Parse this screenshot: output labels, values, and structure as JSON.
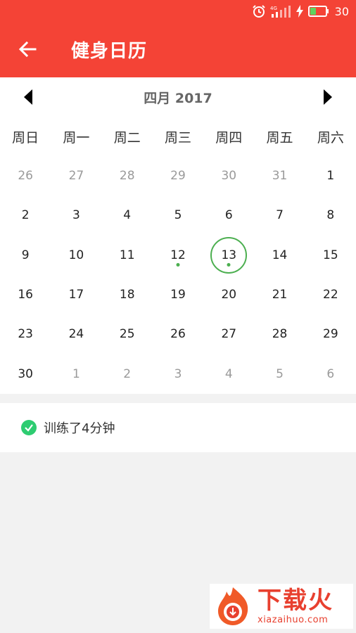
{
  "status": {
    "network": "4G",
    "battery": "30"
  },
  "toolbar": {
    "title": "健身日历"
  },
  "calendar": {
    "month_label": "四月 2017",
    "weekdays": [
      "周日",
      "周一",
      "周二",
      "周三",
      "周四",
      "周五",
      "周六"
    ],
    "days": [
      {
        "label": "26",
        "muted": true
      },
      {
        "label": "27",
        "muted": true
      },
      {
        "label": "28",
        "muted": true
      },
      {
        "label": "29",
        "muted": true
      },
      {
        "label": "30",
        "muted": true
      },
      {
        "label": "31",
        "muted": true
      },
      {
        "label": "1"
      },
      {
        "label": "2"
      },
      {
        "label": "3"
      },
      {
        "label": "4"
      },
      {
        "label": "5"
      },
      {
        "label": "6"
      },
      {
        "label": "7"
      },
      {
        "label": "8"
      },
      {
        "label": "9"
      },
      {
        "label": "10"
      },
      {
        "label": "11"
      },
      {
        "label": "12",
        "dot": true
      },
      {
        "label": "13",
        "selected": true,
        "dot": true
      },
      {
        "label": "14"
      },
      {
        "label": "15"
      },
      {
        "label": "16"
      },
      {
        "label": "17"
      },
      {
        "label": "18"
      },
      {
        "label": "19"
      },
      {
        "label": "20"
      },
      {
        "label": "21"
      },
      {
        "label": "22"
      },
      {
        "label": "23"
      },
      {
        "label": "24"
      },
      {
        "label": "25"
      },
      {
        "label": "26"
      },
      {
        "label": "27"
      },
      {
        "label": "28"
      },
      {
        "label": "29"
      },
      {
        "label": "30"
      },
      {
        "label": "1",
        "muted": true
      },
      {
        "label": "2",
        "muted": true
      },
      {
        "label": "3",
        "muted": true
      },
      {
        "label": "4",
        "muted": true
      },
      {
        "label": "5",
        "muted": true
      },
      {
        "label": "6",
        "muted": true
      }
    ]
  },
  "record": {
    "text": "训练了4分钟"
  },
  "watermark": {
    "title": "下载火",
    "url": "xiazaihuo.com"
  },
  "colors": {
    "appbar": "#f44336",
    "accent_green": "#4caf50",
    "check_green": "#2ecc71"
  }
}
